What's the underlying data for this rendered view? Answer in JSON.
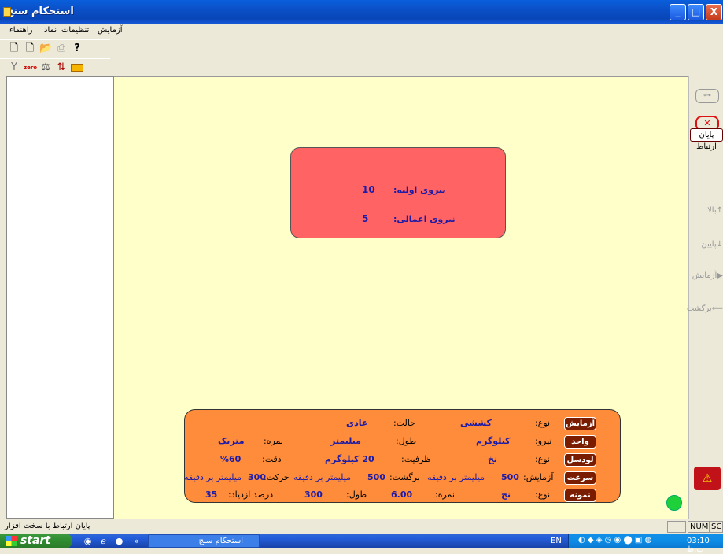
{
  "window": {
    "title": "استحکام سنج",
    "buttons": {
      "minimize": "_",
      "maximize": "□",
      "close": "X"
    }
  },
  "menu": [
    "آزمایش",
    "تنظیمات",
    "نماد",
    "راهنماء"
  ],
  "toolbar1": [
    "new-icon",
    "new-doc-icon",
    "open-icon",
    "print-icon",
    "help-icon"
  ],
  "toolbar2": [
    "tool-icon",
    "zero-icon",
    "balance-icon",
    "sort-icon",
    "keyboard-icon"
  ],
  "toolbar2_zero_label": "zero",
  "force_box": {
    "initial_label": "نیروی اولیه:",
    "initial_value": "10",
    "interrupt_label": "نیروی اعمالی:",
    "interrupt_value": "5"
  },
  "info": {
    "test": {
      "btn": "آزمایش",
      "type_label": "نوع:",
      "type_value": "کششی",
      "mode_label": "حالت:",
      "mode_value": "عادی"
    },
    "unit": {
      "btn": "واحد",
      "force_label": "نیرو:",
      "force_value": "کیلوگرم",
      "length_label": "طول:",
      "length_value": "میلیمتر",
      "grade_label": "نمره:",
      "grade_value": "متریک"
    },
    "loadcell": {
      "btn": "لودسل",
      "type_label": "نوع:",
      "type_value": "نخ",
      "cap_label": "ظرفیت:",
      "cap_value": "20  کیلوگرم",
      "acc_label": "دقت:",
      "acc_value": "%60"
    },
    "speed": {
      "btn": "سرعت",
      "test_label": "آزمایش:",
      "test_value": "500",
      "test_unit": "میلیمتر بر دقیقه",
      "ret_label": "برگشت:",
      "ret_value": "500",
      "ret_unit": "میلیمتر بر دقیقه",
      "move_label": "حرکت:",
      "move_value": "300",
      "move_unit": "میلیمتر بر دقیقه"
    },
    "sample": {
      "btn": "نمونه",
      "type_label": "نوع:",
      "type_value": "نخ",
      "grade_label": "نمره:",
      "grade_value": "6.00",
      "length_label": "طول:",
      "length_value": "300",
      "elong_label": "درصد ازدیاد:",
      "elong_value": "35"
    }
  },
  "right_bar": {
    "end_connection": "پایان ارتباط",
    "up": "بالا",
    "down": "پایین",
    "test": "آزمایش",
    "back": "برگشت"
  },
  "status": {
    "text": "پایان ارتباط با سخت افزار",
    "num": "NUM",
    "scroll": "SC"
  },
  "taskbar": {
    "start": "start",
    "task": "استحکام سنج",
    "lang": "EN",
    "clock": "03:10 ب.ظ",
    "chevron": "»"
  },
  "colors": {
    "canvas": "#ffffc9",
    "force_box": "#ff6363",
    "info_box": "#ff8c3a",
    "button": "#7a1c00",
    "value_text": "#1c1ca8"
  }
}
